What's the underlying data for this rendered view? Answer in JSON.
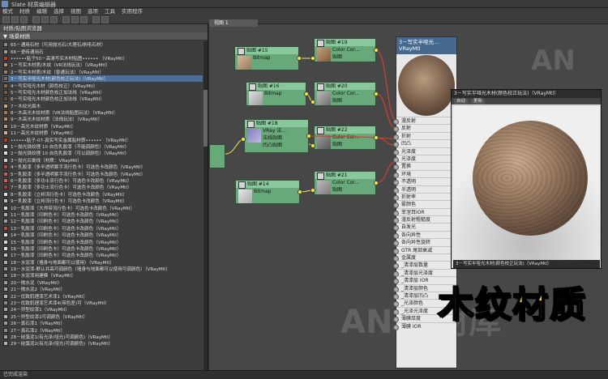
{
  "window": {
    "title": "Slate 材质编辑器"
  },
  "menu": [
    "模式",
    "材质",
    "编辑",
    "选择",
    "视图",
    "选项",
    "工具",
    "实用程序"
  ],
  "browser": {
    "title": "材质/贴图浏览器",
    "group": "▼ 场景材质",
    "items": [
      {
        "text": "65－通用石材（可用抛光石/大理石/刷毛石材）",
        "color": "#8a8a8a"
      },
      {
        "text": "66－瓷砖通用石",
        "color": "#9a9a9a"
      },
      {
        "text": "••••••贴子50－高清写实木材贴图•••••• （VRayMtl）",
        "color": "#c23a2a"
      },
      {
        "text": "1－写实木材质/木纹（VR法线玩法）（VRayMtl）",
        "color": "#b3906b"
      },
      {
        "text": "2－写实木材质/木纹（普通玩法）（VRayMtl）",
        "color": "#a58060"
      },
      {
        "text": "3－写实半哑光木材(颜色校正玩法)（VRayMtl）",
        "color": "#8b6a4e",
        "selected": true
      },
      {
        "text": "4－写实哑光木材（颜色校正）（VRayMtl）",
        "color": "#906a4f"
      },
      {
        "text": "5－写实哑光木材颜色校正加法线（VRayMtl）",
        "color": "#7b5a44"
      },
      {
        "text": "6－写实哑光木材颜色校正加法线（VRayMtl）",
        "color": "#6a4b3a"
      },
      {
        "text": "7－木纹光面木",
        "color": "#caa77f"
      },
      {
        "text": "8－木高光木纹材质（VR法线贴图玩法）（VRayMtl）",
        "color": "#a57b55"
      },
      {
        "text": "9－木高光木纹材质（法线玩法）（VRayMtl）",
        "color": "#b98f66"
      },
      {
        "text": "10－高光木纹材质（VRayMtl）",
        "color": "#c0a080"
      },
      {
        "text": "11－高光木纹材质（VRayMtl）",
        "color": "#d1b08f"
      },
      {
        "text": "••••••贴子-07-真实写实金属贴材质•••••• （VRayMtl）",
        "color": "#c23a2a"
      },
      {
        "text": "1－抛光铁纹理 10 自色乳胶漆（不能调颜色）（VRayMtl）",
        "color": "#e0e0e0"
      },
      {
        "text": "2－抛光铁纹理 10 自色乳胶漆（可以调颜色）（VRayMtl）",
        "color": "#dedede"
      },
      {
        "text": "3－抛光石膏线（材质：VRayMtl）",
        "color": "#d0d0d0"
      },
      {
        "text": "4－乳胶漆（多半透明紫手流行色卡）可选色卡改颜色（VRayMtl）",
        "color": "#b44a4a"
      },
      {
        "text": "5－乳胶漆（多半透明紫手流行色卡）可选色卡改颜色（VRayMtl）",
        "color": "#c85a5a"
      },
      {
        "text": "6－乳胶漆（多功士流行色卡）可选色卡改颜色（VRayMtl）",
        "color": "#d45b5b"
      },
      {
        "text": "7－乳胶漆（多功士流行色卡）可选色卡改颜色（VRayMtl）",
        "color": "#a83c3c"
      },
      {
        "text": "8－乳胶漆（立邦流行色卡）可选色卡改颜色（VRayMtl）",
        "color": "#e0e0e0"
      },
      {
        "text": "9－乳胶漆（立邦流行色卡）可选色卡改颜色（VRayMtl）",
        "color": "#bfbfbf"
      },
      {
        "text": "10－乳胶漆（大师带流行色卡）可选色卡改颜色（VRayMtl）",
        "color": "#d9d9d9"
      },
      {
        "text": "11－乳胶漆（印刷色卡）可选色卡改颜色（VRayMtl）",
        "color": "#b0b0b0"
      },
      {
        "text": "12－乳胶漆（印刷色卡）可选色卡改颜色（VRayMtl）",
        "color": "#a0a0a0"
      },
      {
        "text": "13－乳胶漆（印刷色卡）可选色卡改颜色（VRayMtl）",
        "color": "#c44a4a"
      },
      {
        "text": "14－乳胶漆（印刷色卡）可选色卡改颜色（VRayMtl）",
        "color": "#e6e6e6"
      },
      {
        "text": "15－乳胶漆（印刷色卡）可选色卡改颜色（VRayMtl）",
        "color": "#d4d4d4"
      },
      {
        "text": "16－乳胶漆（印刷色卡）可选色卡改颜色（VRayMtl）",
        "color": "#e2e2e2"
      },
      {
        "text": "17－乳胶漆（印刷色卡）可选色卡改颜色（VRayMtl）",
        "color": "#c6c6c6"
      },
      {
        "text": "18－水泥漆（墙身与地面都可以使用）（VRayMtl）",
        "color": "#a8a8a8"
      },
      {
        "text": "19－水泥漆-默认并高可调颜色（墙身与地面都可以使用可调颜色）（VRayMtl）",
        "color": "#999999"
      },
      {
        "text": "18－水泥漆用建模（VRayMtl）",
        "color": "#8e8e8e"
      },
      {
        "text": "20－微水泥（VRayMtl）",
        "color": "#9c9c9c"
      },
      {
        "text": "21－微水泥2（VRayMtl）",
        "color": "#a2a2a2"
      },
      {
        "text": "22－优致肌理漆艺术漆1（VRayMtl）",
        "color": "#b8b8b8"
      },
      {
        "text": "23－优致肌理漆艺术漆4(带色差)可（VRayMtl）",
        "color": "#8c8c8c"
      },
      {
        "text": "24－异型纹漆1（VRayMtl）",
        "color": "#a6a6a6"
      },
      {
        "text": "25－异型纹漆2可调颜色（VRayMtl）",
        "color": "#b4b4b4"
      },
      {
        "text": "26－真石漆1（VRayMtl）",
        "color": "#9a9a9a"
      },
      {
        "text": "27－真石漆2（VRayMtl）",
        "color": "#8a8a8a"
      },
      {
        "text": "28－硅藻泥1(有光泽(哑光)可调颜色)（VRayMtl）",
        "color": "#a0a0a0"
      },
      {
        "text": "29－硅藻泥2(有光泽(哑光)可调颜色)（VRayMtl）",
        "color": "#b2b2b2"
      }
    ]
  },
  "view_tab": "视图 1",
  "nodes": [
    {
      "name": "贴图 #15",
      "type": "Bitmap"
    },
    {
      "name": "贴图 #19",
      "type": "Color Cor...",
      "out": "贴图"
    },
    {
      "name": "贴图 #16",
      "type": "Bitmap"
    },
    {
      "name": "贴图 #20",
      "type": "Color Cor...",
      "out": "贴图"
    },
    {
      "name": "贴图 #18",
      "type": "VRay 法...",
      "p1": "法线贴图",
      "p2": "凹凸贴图"
    },
    {
      "name": "贴图 #22",
      "type": "Color Cor...",
      "out": "贴图"
    },
    {
      "name": "贴图 #14",
      "type": "Bitmap"
    },
    {
      "name": "贴图 #21",
      "type": "Color Cor...",
      "out": "贴图"
    }
  ],
  "vraymtl": {
    "title": "3－写实半哑光...",
    "type": "VRayMtl",
    "slots": [
      "漫反射",
      "反射",
      "折射",
      "凹凸",
      "光泽度",
      "光泽度",
      "置换",
      "环境",
      "不透明",
      "半透明",
      "折射率",
      "雾颜色",
      "菲涅耳IOR",
      "漫反射粗糙度",
      "自发光",
      "各向异性",
      "各向异性旋转",
      "GTR 尾部衰减",
      "金属度",
      "_清漆层数量",
      "_清漆层光泽度",
      "_清漆层 IOR",
      "_清漆层颜色",
      "_清漆层凹凸",
      "_光泽颜色",
      "_光泽光泽度",
      "薄膜厚度",
      "薄膜 IOR"
    ]
  },
  "preview": {
    "title": "3－写实半哑光木材(颜色校正玩法)（VRayMtl）",
    "auto_label": "自动",
    "update_label": "更新",
    "caption": "3－写实半哑光木材(颜色校正玩法)（VRayMtl）"
  },
  "overlay_title": "木纹材质",
  "watermark": {
    "big": "AN",
    "mid": "AN 素材库"
  },
  "status": "已完成渲染"
}
